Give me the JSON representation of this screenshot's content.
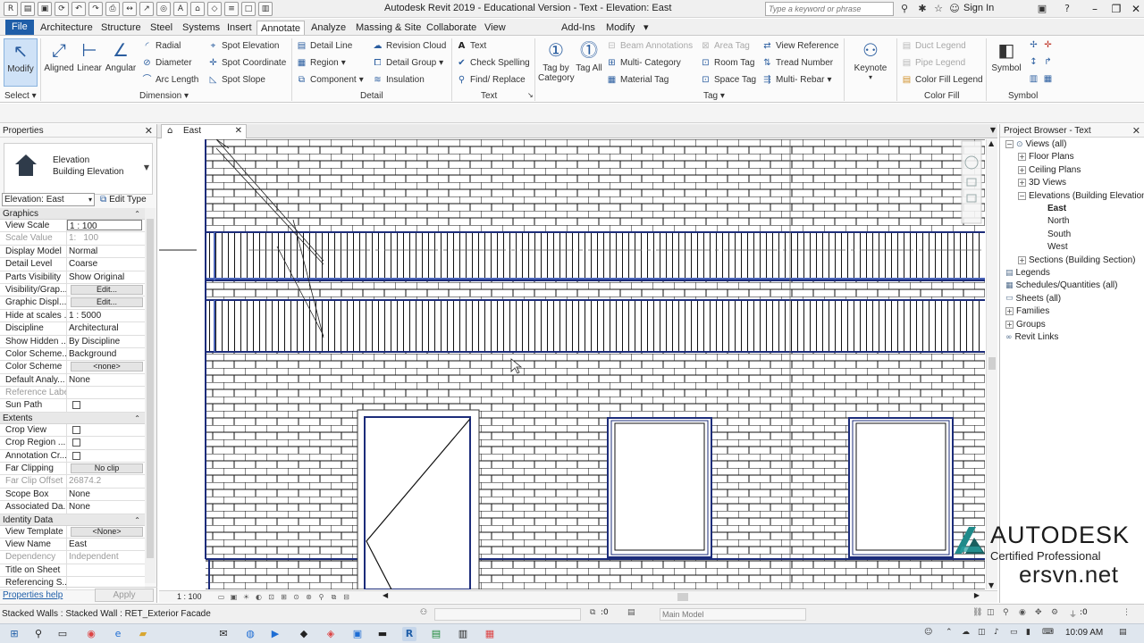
{
  "app": {
    "title": "Autodesk Revit 2019 - Educational Version - Text - Elevation: East",
    "search_placeholder": "Type a keyword or phrase",
    "sign_in": "Sign In"
  },
  "icons": {
    "qat": [
      "app-menu-icon",
      "open-icon",
      "save-icon",
      "sync-icon",
      "undo-icon",
      "redo-icon",
      "print-icon",
      "measure-icon",
      "dimension-icon",
      "tag-icon",
      "text-icon",
      "3d-view-icon",
      "section-icon",
      "thin-lines-icon",
      "close-hidden-icon",
      "switch-windows-icon"
    ],
    "title_right": [
      "binoculars-icon",
      "subscription-icon",
      "favorites-icon",
      "user-icon",
      "cart-icon",
      "help-icon"
    ]
  },
  "tabs": [
    "File",
    "Architecture",
    "Structure",
    "Steel",
    "Systems",
    "Insert",
    "Annotate",
    "Analyze",
    "Massing & Site",
    "Collaborate",
    "View",
    "Add-Ins",
    "Modify"
  ],
  "active_tab": "Annotate",
  "ribbon": {
    "select": {
      "modify": "Modify",
      "panel": "Select"
    },
    "dimension": {
      "aligned": "Aligned",
      "linear": "Linear",
      "angular": "Angular",
      "radial": "Radial",
      "diameter": "Diameter",
      "arc_length": "Arc  Length",
      "spot_elevation": "Spot  Elevation",
      "spot_coordinate": "Spot  Coordinate",
      "spot_slope": "Spot  Slope",
      "panel": "Dimension"
    },
    "detail": {
      "detail_line": "Detail  Line",
      "region": "Region",
      "component": "Component",
      "revision_cloud": "Revision  Cloud",
      "detail_group": "Detail  Group",
      "insulation": "Insulation",
      "panel": "Detail"
    },
    "text": {
      "text": "Text",
      "check_spelling": "Check  Spelling",
      "find_replace": "Find/  Replace",
      "panel": "Text"
    },
    "tag": {
      "tag_by_category": "Tag by Category",
      "tag_all": "Tag All",
      "beam_annotations": "Beam  Annotations",
      "multi_category": "Multi-  Category",
      "material_tag": "Material  Tag",
      "area_tag": "Area  Tag",
      "room_tag": "Room  Tag",
      "space_tag": "Space  Tag",
      "view_reference": "View  Reference",
      "tread_number": "Tread  Number",
      "multi_rebar": "Multi-  Rebar",
      "keynote": "Keynote",
      "panel": "Tag"
    },
    "color_fill": {
      "duct_legend": "Duct  Legend",
      "pipe_legend": "Pipe  Legend",
      "color_fill_legend": "Color Fill  Legend",
      "panel": "Color Fill"
    },
    "symbol": {
      "symbol": "Symbol",
      "panel": "Symbol"
    }
  },
  "properties": {
    "title": "Properties",
    "type_family": "Elevation",
    "type_name": "Building Elevation",
    "instance": "Elevation: East",
    "edit_type": "Edit Type",
    "groups": [
      {
        "name": "Graphics",
        "rows": [
          {
            "n": "View Scale",
            "v": "1 : 100",
            "boxed": true
          },
          {
            "n": "Scale Value",
            "v": "1:",
            "v2": "100",
            "dis": true
          },
          {
            "n": "Display Model",
            "v": "Normal"
          },
          {
            "n": "Detail Level",
            "v": "Coarse"
          },
          {
            "n": "Parts Visibility",
            "v": "Show Original"
          },
          {
            "n": "Visibility/Grap...",
            "btn": "Edit..."
          },
          {
            "n": "Graphic Displ...",
            "btn": "Edit..."
          },
          {
            "n": "Hide at scales ...",
            "v": "1 : 5000"
          },
          {
            "n": "Discipline",
            "v": "Architectural"
          },
          {
            "n": "Show Hidden ...",
            "v": "By Discipline"
          },
          {
            "n": "Color Scheme...",
            "v": "Background"
          },
          {
            "n": "Color Scheme",
            "btn": "<none>"
          },
          {
            "n": "Default Analy...",
            "v": "None"
          },
          {
            "n": "Reference Label",
            "v": "",
            "dis": true
          },
          {
            "n": "Sun Path",
            "chk": true
          }
        ]
      },
      {
        "name": "Extents",
        "rows": [
          {
            "n": "Crop View",
            "chk": true
          },
          {
            "n": "Crop Region ...",
            "chk": true
          },
          {
            "n": "Annotation Cr...",
            "chk": true
          },
          {
            "n": "Far Clipping",
            "btn": "No clip"
          },
          {
            "n": "Far Clip Offset",
            "v": "26874.2",
            "dis": true
          },
          {
            "n": "Scope Box",
            "v": "None"
          },
          {
            "n": "Associated Da...",
            "v": "None"
          }
        ]
      },
      {
        "name": "Identity Data",
        "rows": [
          {
            "n": "View Template",
            "btn": "<None>"
          },
          {
            "n": "View Name",
            "v": "East"
          },
          {
            "n": "Dependency",
            "v": "Independent",
            "dis": true
          },
          {
            "n": "Title on Sheet",
            "v": ""
          },
          {
            "n": "Referencing S...",
            "v": ""
          }
        ]
      }
    ],
    "help": "Properties help",
    "apply": "Apply"
  },
  "view": {
    "tab": "East",
    "scale": "1 : 100"
  },
  "browser": {
    "title": "Project Browser - Text",
    "items": [
      {
        "label": "Views (all)",
        "lvl": 0,
        "toggle": "−",
        "icon": "views-icon"
      },
      {
        "label": "Floor Plans",
        "lvl": 1,
        "toggle": "+"
      },
      {
        "label": "Ceiling Plans",
        "lvl": 1,
        "toggle": "+"
      },
      {
        "label": "3D Views",
        "lvl": 1,
        "toggle": "+"
      },
      {
        "label": "Elevations (Building Elevation)",
        "lvl": 1,
        "toggle": "−"
      },
      {
        "label": "East",
        "lvl": 2,
        "bold": true
      },
      {
        "label": "North",
        "lvl": 2
      },
      {
        "label": "South",
        "lvl": 2
      },
      {
        "label": "West",
        "lvl": 2
      },
      {
        "label": "Sections (Building Section)",
        "lvl": 1,
        "toggle": "+"
      },
      {
        "label": "Legends",
        "lvl": 0,
        "icon": "legends-icon"
      },
      {
        "label": "Schedules/Quantities (all)",
        "lvl": 0,
        "icon": "schedules-icon"
      },
      {
        "label": "Sheets (all)",
        "lvl": 0,
        "icon": "sheets-icon"
      },
      {
        "label": "Families",
        "lvl": 0,
        "toggle": "+"
      },
      {
        "label": "Groups",
        "lvl": 0,
        "toggle": "+"
      },
      {
        "label": "Revit Links",
        "lvl": 0,
        "icon": "links-icon"
      }
    ]
  },
  "watermark": {
    "brand": "AUTODESK",
    "sub": "Certified Professional",
    "site": "ersvn.net"
  },
  "status": {
    "text": "Stacked Walls : Stacked Wall : RET_Exterior Facade",
    "worksets": ":0",
    "model": "Main Model",
    "filter": ":0"
  },
  "taskbar": {
    "time": "10:09 AM"
  },
  "colors": {
    "accent": "#1f5ea8",
    "wall_outline": "#1c2c7a",
    "ribbon_bg": "#fbfbfb"
  }
}
